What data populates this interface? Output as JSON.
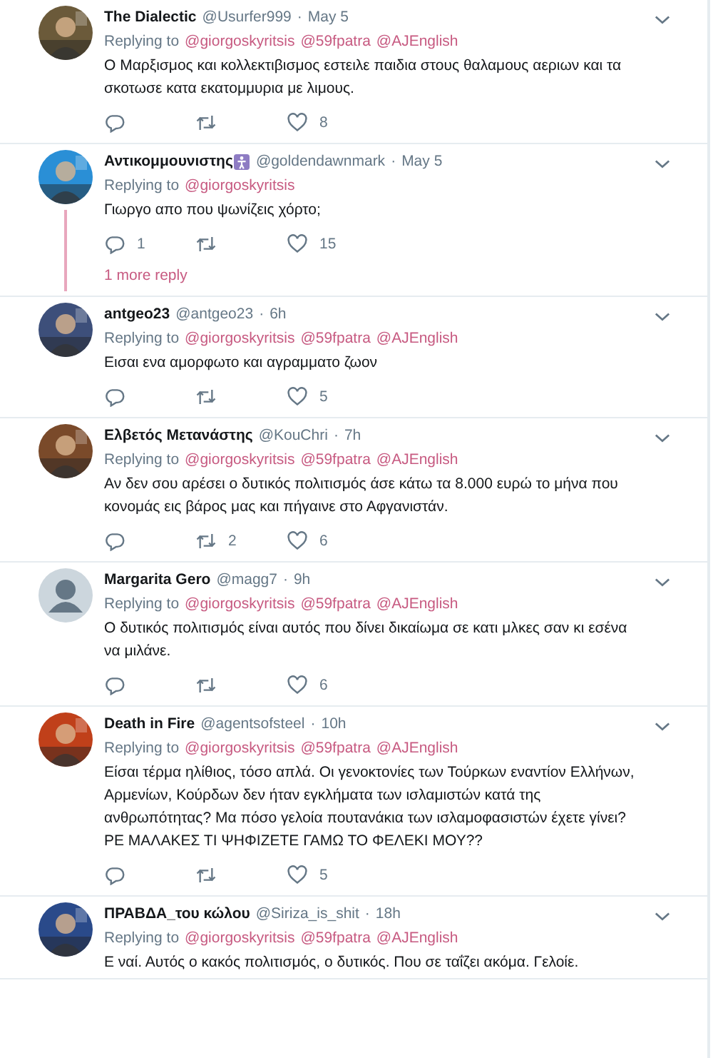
{
  "separator": "·",
  "tweets": [
    {
      "name": "The Dialectic",
      "handle": "@Usurfer999",
      "time": "May 5",
      "replying_label": "Replying to",
      "replying_to": [
        "@giorgoskyritsis",
        "@59fpatra",
        "@AJEnglish"
      ],
      "text": "Ο Μαρξισμος και κολλεκτιβισμος εστειλε παιδια στους θαλαμους αεριων και τα σκοτωσε κατα εκατομμυρια με λιμους.",
      "actions": [
        {
          "kind": "reply"
        },
        {
          "kind": "retweet"
        },
        {
          "kind": "like",
          "count": "8"
        }
      ]
    },
    {
      "name": "Αντικομμουνιστης",
      "badge": true,
      "handle": "@goldendawnmark",
      "time": "May 5",
      "replying_label": "Replying to",
      "replying_to": [
        "@giorgoskyritsis"
      ],
      "text": "Γιωργο απο που ψωνίζεις χόρτο;",
      "actions": [
        {
          "kind": "reply",
          "count": "1"
        },
        {
          "kind": "retweet"
        },
        {
          "kind": "like",
          "count": "15"
        }
      ],
      "more_replies": "1 more reply"
    },
    {
      "name": "antgeo23",
      "handle": "@antgeo23",
      "time": "6h",
      "replying_label": "Replying to",
      "replying_to": [
        "@giorgoskyritsis",
        "@59fpatra",
        "@AJEnglish"
      ],
      "text": "Εισαι ενα αμορφωτο και αγραμματο ζωον",
      "actions": [
        {
          "kind": "reply"
        },
        {
          "kind": "retweet"
        },
        {
          "kind": "like",
          "count": "5"
        }
      ]
    },
    {
      "name": "Ελβετός Μετανάστης",
      "handle": "@KouChri",
      "time": "7h",
      "replying_label": "Replying to",
      "replying_to": [
        "@giorgoskyritsis",
        "@59fpatra",
        "@AJEnglish"
      ],
      "text": "Αν δεν σου αρέσει ο δυτικός πολιτισμός άσε κάτω τα 8.000 ευρώ το μήνα που κονομάς εις βάρος μας και πήγαινε στο Αφγανιστάν.",
      "actions": [
        {
          "kind": "reply"
        },
        {
          "kind": "retweet",
          "count": "2"
        },
        {
          "kind": "like",
          "count": "6"
        }
      ]
    },
    {
      "name": "Margarita Gero",
      "handle": "@magg7",
      "time": "9h",
      "avatar": {
        "kind": "default",
        "color": "#ccd6dd"
      },
      "replying_label": "Replying to",
      "replying_to": [
        "@giorgoskyritsis",
        "@59fpatra",
        "@AJEnglish"
      ],
      "text": "Ο δυτικός πολιτισμός είναι αυτός που δίνει δικαίωμα σε κατι μλκες σαν κι εσένα να μιλάνε.",
      "actions": [
        {
          "kind": "reply"
        },
        {
          "kind": "retweet"
        },
        {
          "kind": "like",
          "count": "6"
        }
      ]
    },
    {
      "name": "Death in Fire",
      "handle": "@agentsofsteel",
      "time": "10h",
      "replying_label": "Replying to",
      "replying_to": [
        "@giorgoskyritsis",
        "@59fpatra",
        "@AJEnglish"
      ],
      "text": "Είσαι τέρμα ηλίθιος, τόσο απλά. Οι γενοκτονίες των Τούρκων εναντίον Ελλήνων, Αρμενίων, Κούρδων δεν ήταν εγκλήματα των ισλαμιστών κατά της ανθρωπότητας? Μα πόσο γελοία πουτανάκια των ισλαμοφασιστών έχετε γίνει? ΡΕ ΜΑΛΑΚΕΣ ΤΙ ΨΗΦΙΖΕΤΕ ΓΑΜΩ ΤΟ ΦΕΛΕΚΙ ΜΟΥ??",
      "actions": [
        {
          "kind": "reply"
        },
        {
          "kind": "retweet"
        },
        {
          "kind": "like",
          "count": "5"
        }
      ]
    },
    {
      "name": "ΠΡΑΒΔΑ_του κώλου",
      "handle": "@Siriza_is_shit",
      "time": "18h",
      "replying_label": "Replying to",
      "replying_to": [
        "@giorgoskyritsis",
        "@59fpatra",
        "@AJEnglish"
      ],
      "text": "Ε ναί. Αυτός ο κακός πολιτισμός, ο δυτικός. Που σε ταΐζει ακόμα. Γελοίε."
    }
  ]
}
